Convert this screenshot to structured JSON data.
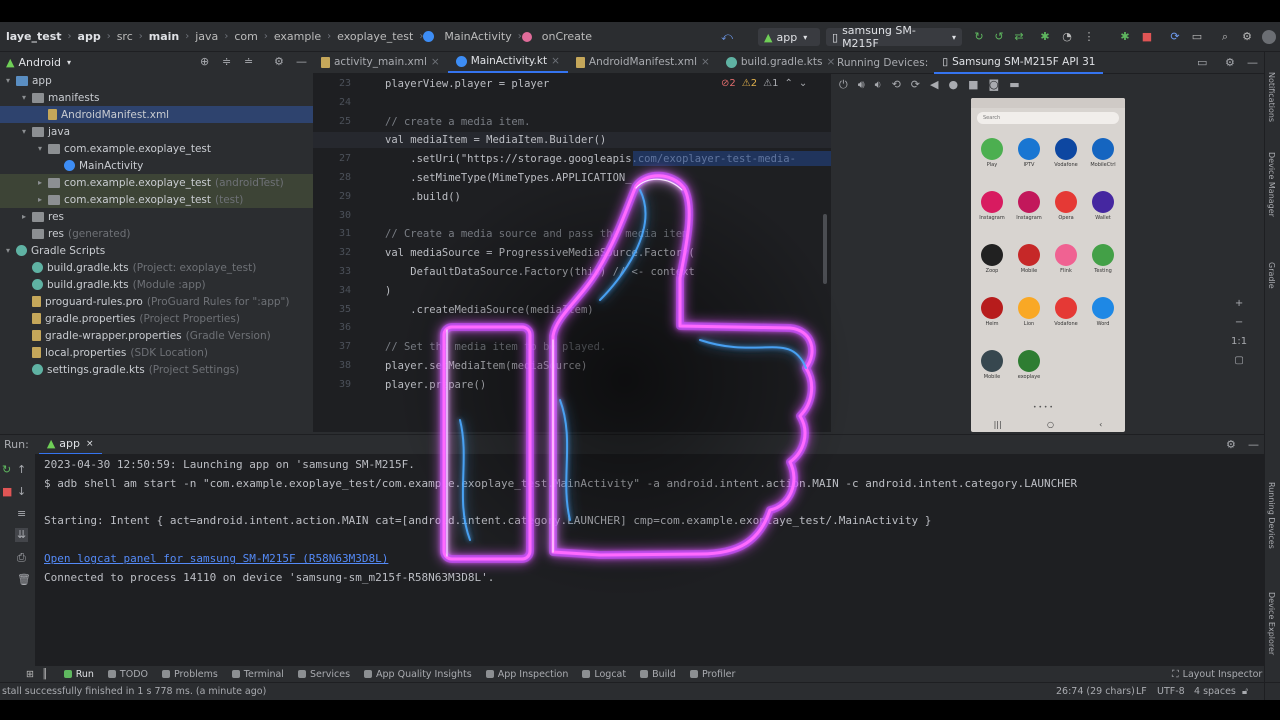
{
  "breadcrumb": {
    "items": [
      "laye_test",
      "app",
      "src",
      "main",
      "java",
      "com",
      "example",
      "exoplaye_test",
      "MainActivity",
      "onCreate"
    ]
  },
  "toolbar": {
    "run_config": "app",
    "device": "samsung SM-M215F"
  },
  "project_panel": {
    "view_mode": "Android",
    "tree": [
      {
        "label": "app",
        "meta": "",
        "indent": 0,
        "icon": "folder-blue",
        "arrow": "down"
      },
      {
        "label": "manifests",
        "meta": "",
        "indent": 1,
        "icon": "folder",
        "arrow": "down"
      },
      {
        "label": "AndroidManifest.xml",
        "meta": "",
        "indent": 2,
        "icon": "file",
        "arrow": "",
        "selected": true
      },
      {
        "label": "java",
        "meta": "",
        "indent": 1,
        "icon": "folder",
        "arrow": "down"
      },
      {
        "label": "com.example.exoplaye_test",
        "meta": "",
        "indent": 2,
        "icon": "folder",
        "arrow": "down"
      },
      {
        "label": "MainActivity",
        "meta": "",
        "indent": 3,
        "icon": "kotlin",
        "arrow": ""
      },
      {
        "label": "com.example.exoplaye_test",
        "meta": "(androidTest)",
        "indent": 2,
        "icon": "folder",
        "arrow": "right",
        "highlight": true
      },
      {
        "label": "com.example.exoplaye_test",
        "meta": "(test)",
        "indent": 2,
        "icon": "folder",
        "arrow": "right",
        "highlight": true
      },
      {
        "label": "res",
        "meta": "",
        "indent": 1,
        "icon": "folder",
        "arrow": "right"
      },
      {
        "label": "res",
        "meta": "(generated)",
        "indent": 1,
        "icon": "folder",
        "arrow": ""
      },
      {
        "label": "Gradle Scripts",
        "meta": "",
        "indent": 0,
        "icon": "gradle",
        "arrow": "down"
      },
      {
        "label": "build.gradle.kts",
        "meta": "(Project: exoplaye_test)",
        "indent": 1,
        "icon": "gradle",
        "arrow": ""
      },
      {
        "label": "build.gradle.kts",
        "meta": "(Module :app)",
        "indent": 1,
        "icon": "gradle",
        "arrow": ""
      },
      {
        "label": "proguard-rules.pro",
        "meta": "(ProGuard Rules for \":app\")",
        "indent": 1,
        "icon": "file",
        "arrow": ""
      },
      {
        "label": "gradle.properties",
        "meta": "(Project Properties)",
        "indent": 1,
        "icon": "file",
        "arrow": ""
      },
      {
        "label": "gradle-wrapper.properties",
        "meta": "(Gradle Version)",
        "indent": 1,
        "icon": "file",
        "arrow": ""
      },
      {
        "label": "local.properties",
        "meta": "(SDK Location)",
        "indent": 1,
        "icon": "file",
        "arrow": ""
      },
      {
        "label": "settings.gradle.kts",
        "meta": "(Project Settings)",
        "indent": 1,
        "icon": "gradle",
        "arrow": ""
      }
    ]
  },
  "editor": {
    "tabs": [
      {
        "label": "activity_main.xml",
        "active": false
      },
      {
        "label": "MainActivity.kt",
        "active": true
      },
      {
        "label": "AndroidManifest.xml",
        "active": false
      },
      {
        "label": "build.gradle.kts",
        "active": false
      }
    ],
    "inspections": {
      "errors": "2",
      "warnings": "2",
      "weak": "1"
    },
    "line_numbers": [
      "23",
      "24",
      "25",
      "26",
      "27",
      "28",
      "29",
      "30",
      "31",
      "32",
      "33",
      "34",
      "35",
      "36",
      "37",
      "38",
      "39"
    ],
    "current_line": "26",
    "lines": [
      "playerView.player = player",
      "",
      "// create a media item.",
      "val mediaItem = MediaItem.Builder()",
      "    .setUri(\"https://storage.googleapis.com/exoplayer-test-media-",
      "    .setMimeType(MimeTypes.APPLICATION_",
      "    .build()",
      "",
      "// Create a media source and pass the media item",
      "val mediaSource = ProgressiveMediaSource.Factory(",
      "    DefaultDataSource.Factory(this) // <- context",
      ")",
      "    .createMediaSource(mediaItem)",
      "",
      "// Set the media item to be played.",
      "player.setMediaItem(mediaSource)",
      "player.prepare()"
    ]
  },
  "running_devices": {
    "label": "Running Devices:",
    "tab": "Samsung SM-M215F API 31",
    "zoom": "1:1",
    "phone": {
      "search": "Search",
      "apps": [
        {
          "name": "Play",
          "color": "#4caf50"
        },
        {
          "name": "IPTV",
          "color": "#1976d2"
        },
        {
          "name": "Vodafone",
          "color": "#0d47a1"
        },
        {
          "name": "MobileCtrl",
          "color": "#1565c0"
        },
        {
          "name": "Instagram",
          "color": "#d81b60"
        },
        {
          "name": "Instagram",
          "color": "#c2185b"
        },
        {
          "name": "Opera",
          "color": "#e53935"
        },
        {
          "name": "Wallet",
          "color": "#4527a0"
        },
        {
          "name": "Zoop",
          "color": "#212121"
        },
        {
          "name": "Mobile",
          "color": "#c62828"
        },
        {
          "name": "Flink",
          "color": "#f06292"
        },
        {
          "name": "Testing",
          "color": "#43a047"
        },
        {
          "name": "Heim",
          "color": "#b71c1c"
        },
        {
          "name": "Lion",
          "color": "#f9a825"
        },
        {
          "name": "Vodafone",
          "color": "#e53935"
        },
        {
          "name": "Word",
          "color": "#1e88e5"
        },
        {
          "name": "Mobile",
          "color": "#37474f"
        },
        {
          "name": "exoplaye",
          "color": "#2e7d32"
        }
      ]
    }
  },
  "run_panel": {
    "header": "app",
    "output": [
      {
        "text": "2023-04-30 12:50:59: Launching app on 'samsung SM-M215F.",
        "link": false
      },
      {
        "text": "$ adb shell am start -n \"com.example.exoplaye_test/com.example.exoplaye_test.MainActivity\" -a android.intent.action.MAIN -c android.intent.category.LAUNCHER",
        "link": false
      },
      {
        "text": "",
        "link": false
      },
      {
        "text": "Starting: Intent { act=android.intent.action.MAIN cat=[android.intent.category.LAUNCHER] cmp=com.example.exoplaye_test/.MainActivity }",
        "link": false
      },
      {
        "text": "",
        "link": false
      },
      {
        "text": "Open logcat panel for samsung SM-M215F (R58N63M3D8L)",
        "link": true
      },
      {
        "text": "Connected to process 14110 on device 'samsung-sm_m215f-R58N63M3D8L'.",
        "link": false
      }
    ]
  },
  "tool_windows": [
    "Run",
    "TODO",
    "Problems",
    "Terminal",
    "Services",
    "App Quality Insights",
    "App Inspection",
    "Logcat",
    "Build",
    "Profiler"
  ],
  "layout_inspector": "Layout Inspector",
  "status_bar": {
    "message": "stall successfully finished in 1 s 778 ms. (a minute ago)",
    "position": "26:74 (29 chars)",
    "line_sep": "LF",
    "encoding": "UTF-8",
    "indent": "4 spaces"
  },
  "right_strip_labels": [
    "Notifications",
    "Device Manager",
    "Gradle",
    "Running Devices",
    "Device Explorer"
  ],
  "colors": {
    "accent": "#3574f0",
    "glow_pink": "#ff4dff",
    "glow_blue": "#4aa8ff"
  }
}
